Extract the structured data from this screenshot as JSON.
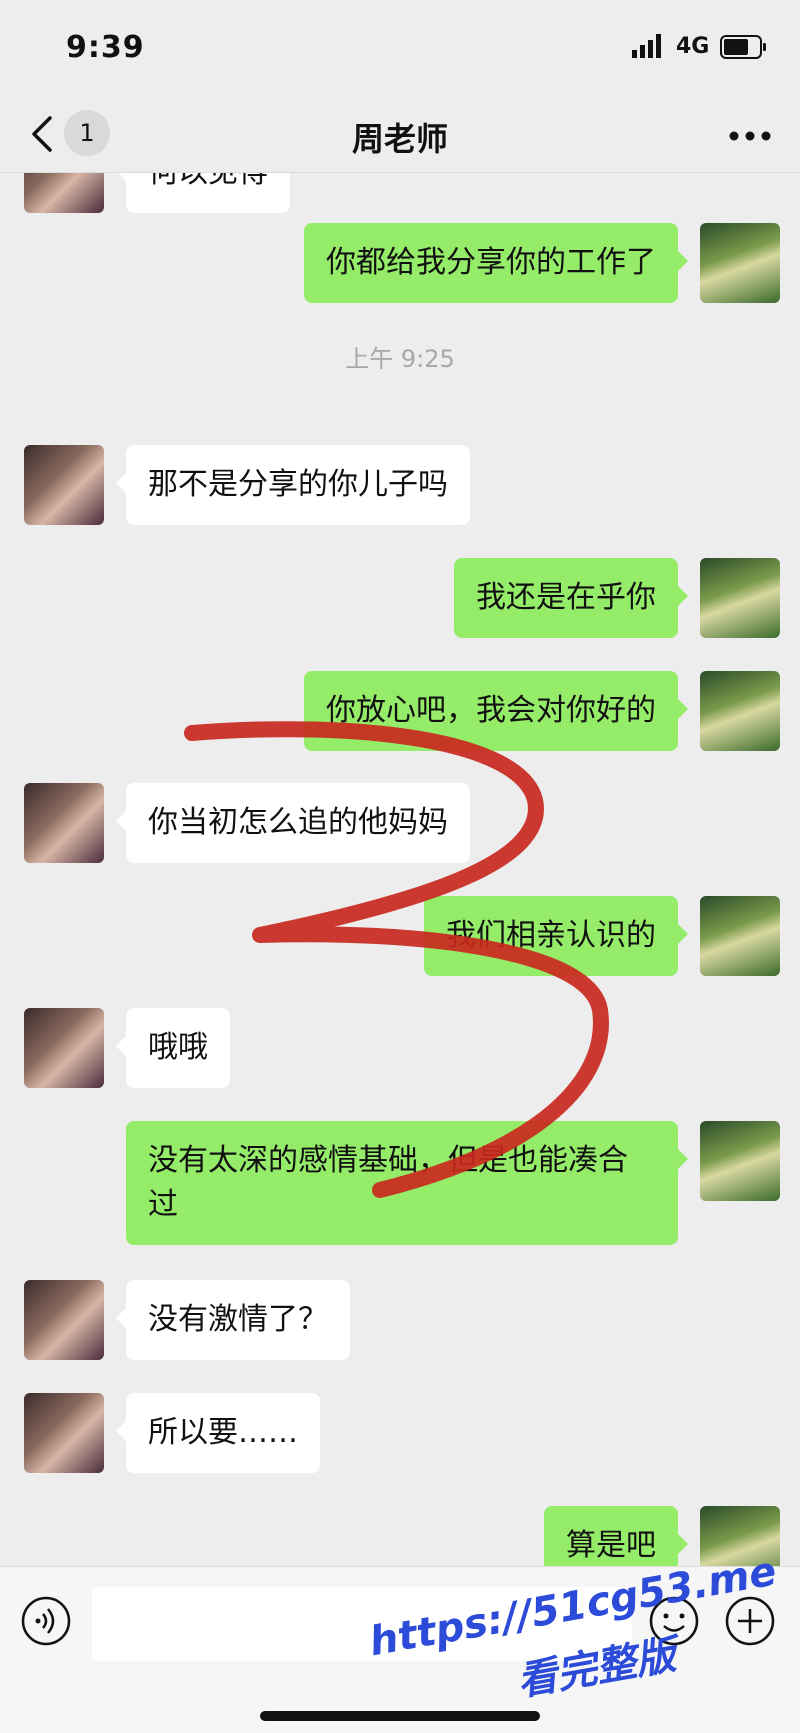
{
  "status_bar": {
    "time": "9:39",
    "network": "4G"
  },
  "nav": {
    "unread_count": "1",
    "title": "周老师"
  },
  "messages": [
    {
      "side": "left",
      "text": "何以见得"
    },
    {
      "side": "right",
      "text": "你都给我分享你的工作了"
    },
    {
      "type": "timestamp",
      "text": "上午 9:25"
    },
    {
      "side": "left",
      "text": "那不是分享的你儿子吗"
    },
    {
      "side": "right",
      "text": "我还是在乎你"
    },
    {
      "side": "right",
      "text": "你放心吧，我会对你好的"
    },
    {
      "side": "left",
      "text": "你当初怎么追的他妈妈"
    },
    {
      "side": "right",
      "text": "我们相亲认识的"
    },
    {
      "side": "left",
      "text": "哦哦"
    },
    {
      "side": "right",
      "text": "没有太深的感情基础，但是也能凑合过"
    },
    {
      "side": "left",
      "text": "没有激情了？"
    },
    {
      "side": "left",
      "text": "所以要……"
    },
    {
      "side": "right",
      "text": "算是吧"
    }
  ],
  "input_bar": {
    "placeholder": ""
  },
  "watermark": {
    "line1": "https://51cg53.me",
    "line2": "看完整版"
  },
  "colors": {
    "background": "#ededed",
    "outgoing_bubble": "#95ec69",
    "incoming_bubble": "#ffffff",
    "annotation": "#c8281e",
    "watermark": "#2b4bd8"
  },
  "icons": [
    "back-chevron-icon",
    "more-icon",
    "voice-icon",
    "emoji-icon",
    "plus-icon",
    "signal-icon",
    "battery-icon"
  ]
}
